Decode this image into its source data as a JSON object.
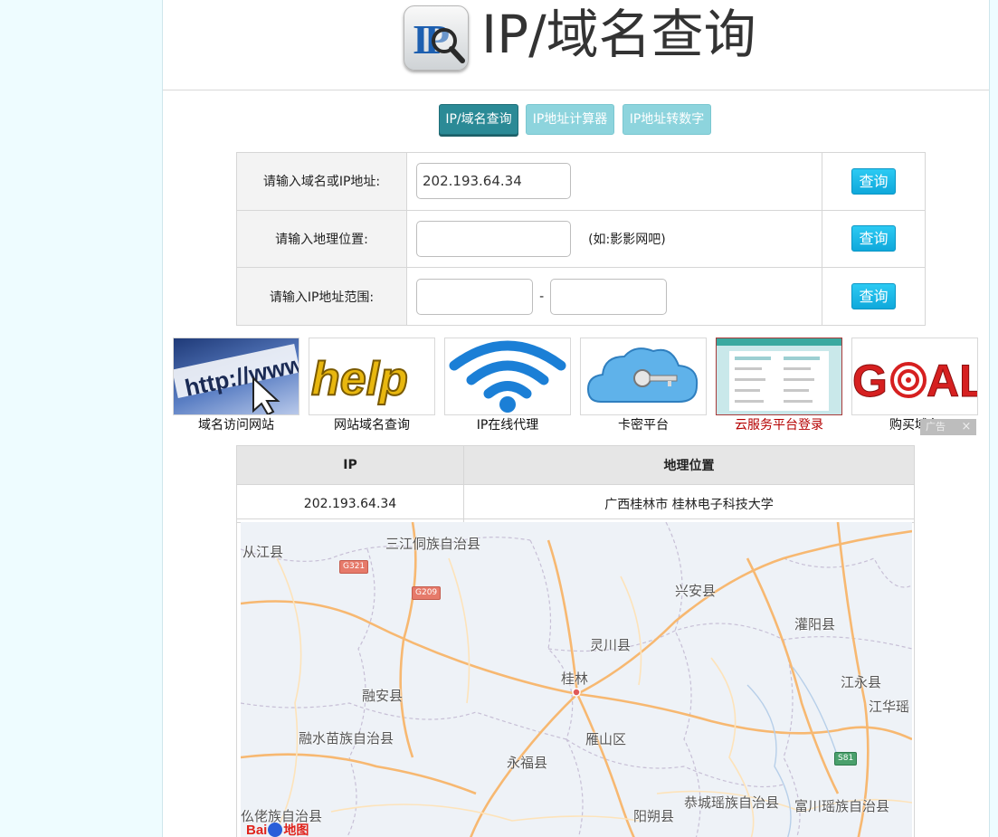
{
  "header": {
    "title": "IP/域名查询",
    "logo_icon": "ip-magnifier-logo-icon"
  },
  "tabs": [
    {
      "label": "IP/域名查询",
      "active": true
    },
    {
      "label": "IP地址计算器",
      "active": false
    },
    {
      "label": "IP地址转数字",
      "active": false
    }
  ],
  "form": {
    "domain_label": "请输入域名或IP地址:",
    "domain_value": "202.193.64.34",
    "location_label": "请输入地理位置:",
    "location_value": "",
    "location_hint": "(如:影影网吧)",
    "range_label": "请输入IP地址范围:",
    "range_start": "",
    "range_sep": "-",
    "range_end": "",
    "query_label": "查询"
  },
  "tiles": [
    {
      "caption": "域名访问网站",
      "image": "http-url-cursor",
      "highlight": false
    },
    {
      "caption": "网站域名查询",
      "image": "help-text",
      "highlight": false
    },
    {
      "caption": "IP在线代理",
      "image": "wifi-signal",
      "highlight": false
    },
    {
      "caption": "卡密平台",
      "image": "cloud-key",
      "highlight": false
    },
    {
      "caption": "云服务平台登录",
      "image": "dashboard-screenshot",
      "highlight": true
    },
    {
      "caption": "购买域名",
      "image": "goal-text",
      "highlight": false
    }
  ],
  "ad": {
    "label": "广告",
    "close": "×"
  },
  "result": {
    "headers": [
      "IP",
      "地理位置"
    ],
    "rows": [
      [
        "202.193.64.34",
        "广西桂林市 桂林电子科技大学"
      ]
    ]
  },
  "map": {
    "labels": [
      "从江县",
      "三江侗族自治县",
      "兴安县",
      "灌阳县",
      "灵川县",
      "桂林",
      "江永县",
      "江华瑶",
      "融安县",
      "雁山区",
      "融水苗族自治县",
      "永福县",
      "恭城瑶族自治县",
      "富川瑶族自治县",
      "阳朔县",
      "仫佬族自治县"
    ],
    "shields": [
      "G321",
      "G209",
      "S81"
    ],
    "brand": "地图",
    "brand_prefix": "Bai"
  },
  "colors": {
    "tab_active": "#2b8a96",
    "tab_inactive": "#8dd4dd",
    "query_button": "#1ab4e6",
    "highlight_caption": "#b50000"
  }
}
